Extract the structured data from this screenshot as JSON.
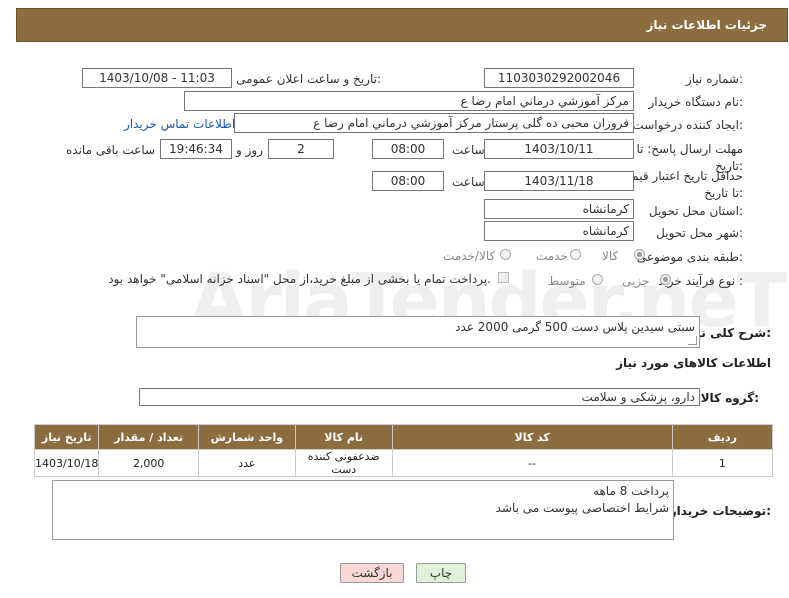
{
  "header": {
    "title": "جزئیات اطلاعات نیاز"
  },
  "form": {
    "need_number_label": "شماره نیاز:",
    "need_number": "1103030292002046",
    "announce_label": "تاریخ و ساعت اعلان عمومی:",
    "announce_value": "1403/10/08 - 11:03",
    "buyer_label": "نام دستگاه خریدار:",
    "buyer_value": "مرکز آموزشي  درماني امام رضا  ع",
    "creator_label": "ایجاد کننده درخواست:",
    "creator_value": "فروزان محبی ده گلی پرستار مرکز آموزشي  درماني امام رضا  ع",
    "contact_link": "اطلاعات تماس خریدار",
    "deadline_label": "مهلت ارسال پاسخ: تا تاریخ:",
    "deadline_date": "1403/10/11",
    "time_label": "ساعت",
    "deadline_time": "08:00",
    "days_value": "2",
    "days_label": "روز و",
    "remaining_time": "19:46:34",
    "remaining_label": "ساعت باقی مانده",
    "min_price_label": "حداقل تاریخ اعتبار قیمت: تا تاریخ:",
    "min_price_date": "1403/11/18",
    "min_price_time": "08:00",
    "province_label": "استان محل تحویل:",
    "province_value": "کرمانشاه",
    "city_label": "شهر محل تحویل:",
    "city_value": "کرمانشاه",
    "category_label": "طبقه بندی موضوعی:",
    "category_options": [
      "کالا",
      "خدمت",
      "کالا/خدمت"
    ],
    "category_selected": "کالا",
    "process_label": "نوع فرآیند خرید :",
    "process_options": [
      "جزیی",
      "متوسط"
    ],
    "process_selected": "جزیی",
    "payment_note": "پرداخت تمام یا بخشی از مبلغ خرید،از محل \"اسناد خزانه اسلامی\" خواهد بود.",
    "description_label": "شرح کلی نیاز:",
    "description_value": "سبتی سیدین پلاس دست 500 گرمی    2000 عدد",
    "goods_info_title": "اطلاعات کالاهای مورد نیاز",
    "goods_group_label": "گروه کالا:",
    "goods_group_value": "دارو، پزشکی و سلامت",
    "buyer_notes_label": "توضیحات خریدار:",
    "buyer_notes_lines": [
      "پرداخت 8 ماهه",
      "شرایط اختصاصی پیوست می باشد"
    ]
  },
  "table": {
    "headers": [
      "ردیف",
      "کد کالا",
      "نام کالا",
      "واحد شمارش",
      "تعداد / مقدار",
      "تاریخ نیاز"
    ],
    "rows": [
      [
        "1",
        "--",
        "ضدعفونی کننده دست",
        "عدد",
        "2,000",
        "1403/10/18"
      ]
    ]
  },
  "buttons": {
    "print": "چاپ",
    "back": "بازگشت"
  },
  "watermark": "AriaTender.neT",
  "colors": {
    "header_bg": "#8b6d3f",
    "link": "#1a5ab5",
    "back_btn_bg": "#f8d7d7",
    "print_btn_bg": "#dff2d8"
  }
}
